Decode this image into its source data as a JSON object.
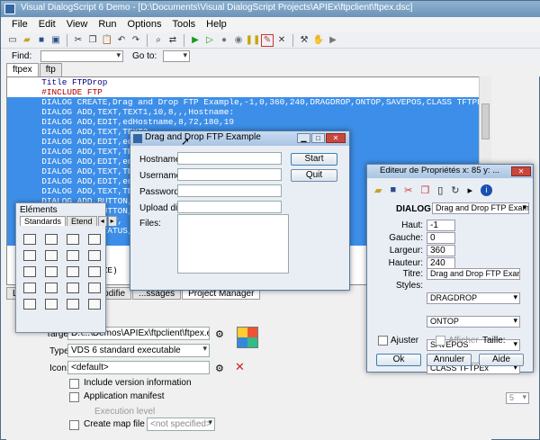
{
  "app": {
    "title": "Visual DialogScript 6 Demo - [D:\\Documents\\Visual DialogScript Projects\\APIEx\\ftpclient\\ftpex.dsc]"
  },
  "menu": [
    "File",
    "Edit",
    "View",
    "Run",
    "Options",
    "Tools",
    "Help"
  ],
  "findbar": {
    "find_label": "Find:",
    "goto_label": "Go to:"
  },
  "tabs": [
    {
      "label": "ftpex"
    },
    {
      "label": "ftp"
    }
  ],
  "code": [
    {
      "text": "  Title FTPDrop",
      "sel": false
    },
    {
      "text": "  #INCLUDE FTP",
      "sel": false
    },
    {
      "text": "  DIALOG CREATE,Drag and Drop FTP Example,-1,0,360,240,DRAGDROP,ONTOP,SAVEPOS,CLASS TFTPEx",
      "sel": true
    },
    {
      "text": "  DIALOG ADD,TEXT,TEXT1,10,8,,,Hostname:",
      "sel": true
    },
    {
      "text": "  DIALOG ADD,EDIT,edHostname,8,72,180,19",
      "sel": true
    },
    {
      "text": "  DIALOG ADD,TEXT,TEXT2,",
      "sel": true
    },
    {
      "text": "  DIALOG ADD,EDIT,edU",
      "sel": true
    },
    {
      "text": "  DIALOG ADD,TEXT,TEX",
      "sel": true
    },
    {
      "text": "  DIALOG ADD,EDIT,ed",
      "sel": true
    },
    {
      "text": "  DIALOG ADD,TEXT,TEX",
      "sel": true
    },
    {
      "text": "  DIALOG ADD,EDIT,ed",
      "sel": true
    },
    {
      "text": "  DIALOG ADD,TEXT,TEX",
      "sel": true
    },
    {
      "text": "  DIALOG ADD,BUTTON,",
      "sel": true
    },
    {
      "text": "  DIALOG ADD,BUTTON,",
      "sel": true
    },
    {
      "text": "  DIALOG ADD,LIST,",
      "sel": true
    },
    {
      "text": "  DIALOG ADD,STATUS,S",
      "sel": true
    },
    {
      "text": "  DIALOG SHOW",
      "sel": true
    },
    {
      "text": "  ",
      "sel": false
    },
    {
      "text": "  ",
      "sel": false
    },
    {
      "text": "  ftp INITIALIZE)",
      "sel": false
    },
    {
      "text": "  ftp 1,0,Wi",
      "sel": false
    }
  ],
  "bottom_tabs": [
    {
      "label": "Li"
    },
    {
      "label": "...odifie"
    },
    {
      "label": "...ssages"
    },
    {
      "label": "Project Manager"
    }
  ],
  "project": {
    "target_label": "Target:",
    "target_value": "D:\\...\\Demos\\APIEx\\ftpclient\\ftpex.exe",
    "type_label": "Type:",
    "type_value": "VDS 6 standard executable",
    "icon_label": "Icon:",
    "icon_value": "<default>",
    "include_version": "Include version information",
    "app_manifest": "Application manifest",
    "exec_level_label": "Execution level",
    "exec_level_value": "<not specified>",
    "create_map": "Create map file"
  },
  "ftp_dialog": {
    "title": "Drag and Drop FTP Example",
    "hostname_label": "Hostname:",
    "username_label": "Username:",
    "password_label": "Password:",
    "upload_label": "Upload dir:",
    "files_label": "Files:",
    "start_button": "Start",
    "quit_button": "Quit"
  },
  "elements_panel": {
    "title": "Eléments",
    "tab_standards": "Standards",
    "tab_etend": "Etend",
    "icons": [
      "ok",
      "doc",
      "?!",
      "img",
      "edit",
      "list",
      "combo",
      "group",
      "radio",
      "check",
      "frame",
      "panel",
      "prog",
      "track",
      "tab",
      "scroll",
      "text",
      "bitmap",
      "shape",
      "sep"
    ]
  },
  "props_panel": {
    "title": "Editeur de Propriétés x: 85 y: ...",
    "dialog_label": "DIALOG",
    "dialog_value": "Drag and Drop FTP Example",
    "haut_label": "Haut:",
    "haut_value": "-1",
    "gauche_label": "Gauche:",
    "gauche_value": "0",
    "largeur_label": "Largeur:",
    "largeur_value": "360",
    "hauteur_label": "Hauteur:",
    "hauteur_value": "240",
    "titre_label": "Titre:",
    "titre_value": "Drag and Drop FTP Example",
    "styles_label": "Styles:",
    "styles": [
      "DRAGDROP",
      "ONTOP",
      "SAVEPOS",
      "CLASS TFTPEx"
    ],
    "ajuster_label": "Ajuster",
    "afficher_label": "Afficher",
    "taille_label": "Taille:",
    "taille_value": "5",
    "ok_button": "Ok",
    "annuler_button": "Annuler",
    "aide_button": "Aide"
  }
}
